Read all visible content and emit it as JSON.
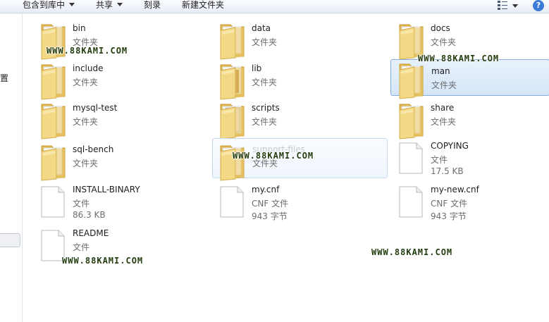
{
  "toolbar": {
    "include_in_library": "包含到库中",
    "share": "共享",
    "burn": "刻录",
    "new_folder": "新建文件夹",
    "help_glyph": "?"
  },
  "nav": {
    "partial_label": "置"
  },
  "items": [
    {
      "name": "bin",
      "type": "文件夹"
    },
    {
      "name": "data",
      "type": "文件夹"
    },
    {
      "name": "docs",
      "type": "文件夹"
    },
    {
      "name": "include",
      "type": "文件夹"
    },
    {
      "name": "lib",
      "type": "文件夹"
    },
    {
      "name": "man",
      "type": "文件夹"
    },
    {
      "name": "mysql-test",
      "type": "文件夹"
    },
    {
      "name": "scripts",
      "type": "文件夹"
    },
    {
      "name": "share",
      "type": "文件夹"
    },
    {
      "name": "sql-bench",
      "type": "文件夹"
    },
    {
      "name": "support-files",
      "type": "文件夹"
    },
    {
      "name": "COPYING",
      "type": "文件",
      "size": "17.5 KB"
    },
    {
      "name": "INSTALL-BINARY",
      "type": "文件",
      "size": "86.3 KB"
    },
    {
      "name": "my.cnf",
      "type": "CNF 文件",
      "size": "943 字节"
    },
    {
      "name": "my-new.cnf",
      "type": "CNF 文件",
      "size": "943 字节"
    },
    {
      "name": "README",
      "type": "文件"
    }
  ],
  "watermark": "WWW.88KAMI.COM",
  "colors": {
    "selection_border": "#84acdd",
    "folder": "#f2d77c",
    "watermark": "#243d10"
  }
}
